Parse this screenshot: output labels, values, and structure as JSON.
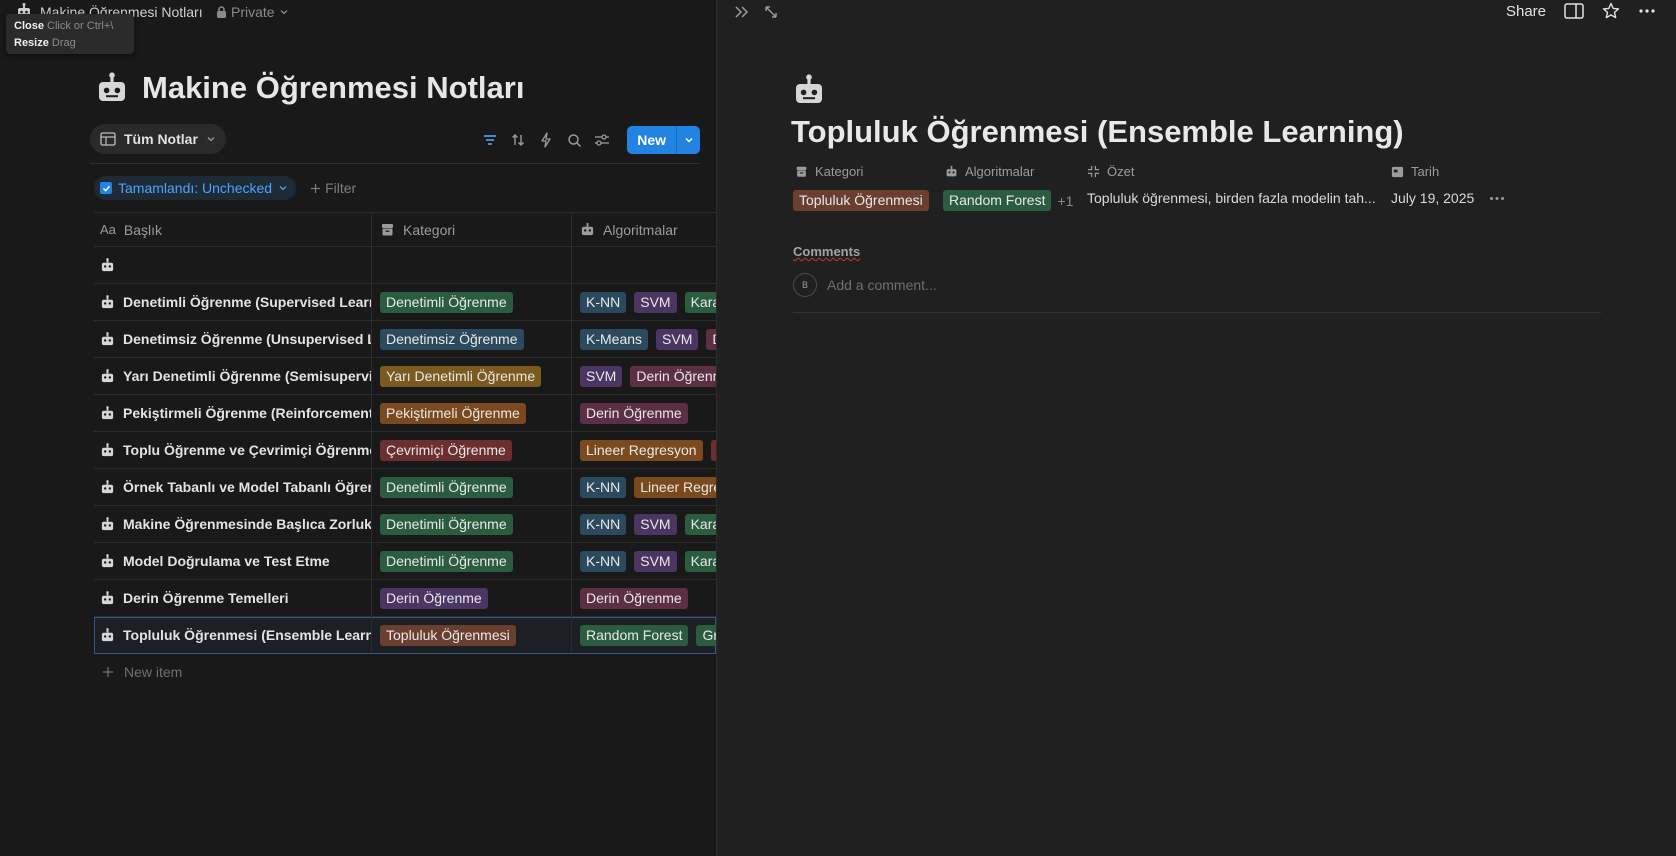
{
  "breadcrumb": {
    "title": "Makine Öğrenmesi Notları",
    "privacy": "Private"
  },
  "tooltip": {
    "close_label": "Close",
    "close_hint": "Click or Ctrl+\\",
    "resize_label": "Resize",
    "resize_hint": "Drag"
  },
  "database": {
    "title": "Makine Öğrenmesi Notları",
    "view_name": "Tüm Notlar",
    "new_label": "New",
    "filter_chip": "Tamamlandı: Unchecked",
    "add_filter": "Filter",
    "new_item": "New item",
    "columns": [
      "Başlık",
      "Kategori",
      "Algoritmalar"
    ],
    "rows": [
      {
        "title": "",
        "category": null,
        "algorithms": []
      },
      {
        "title": "Denetimli Öğrenme (Supervised Learning)",
        "category": {
          "label": "Denetimli Öğrenme",
          "color": "#2b5c3f"
        },
        "algorithms": [
          {
            "label": "K-NN",
            "color": "#2c4a5e"
          },
          {
            "label": "SVM",
            "color": "#4a3563"
          },
          {
            "label": "Karar Ağaçları",
            "color": "#2b5c3f"
          }
        ]
      },
      {
        "title": "Denetimsiz Öğrenme (Unsupervised Learning)",
        "category": {
          "label": "Denetimsiz Öğrenme",
          "color": "#2c4a5e"
        },
        "algorithms": [
          {
            "label": "K-Means",
            "color": "#2c4a5e"
          },
          {
            "label": "SVM",
            "color": "#4a3563"
          },
          {
            "label": "Derin Öğrenme",
            "color": "#5c2f45"
          }
        ]
      },
      {
        "title": "Yarı Denetimli Öğrenme (Semisupervised Learning)",
        "category": {
          "label": "Yarı Denetimli Öğrenme",
          "color": "#7a5a1e"
        },
        "algorithms": [
          {
            "label": "SVM",
            "color": "#4a3563"
          },
          {
            "label": "Derin Öğrenme",
            "color": "#5c2f45"
          }
        ]
      },
      {
        "title": "Pekiştirmeli Öğrenme (Reinforcement Learning)",
        "category": {
          "label": "Pekiştirmeli Öğrenme",
          "color": "#7a4a1e"
        },
        "algorithms": [
          {
            "label": "Derin Öğrenme",
            "color": "#5c2f45"
          }
        ]
      },
      {
        "title": "Toplu Öğrenme ve Çevrimiçi Öğrenme",
        "category": {
          "label": "Çevrimiçi Öğrenme",
          "color": "#6b2f2f"
        },
        "algorithms": [
          {
            "label": "Lineer Regresyon",
            "color": "#7a4a1e"
          },
          {
            "label": "Lojistik Regresyon",
            "color": "#6b2f2f"
          }
        ]
      },
      {
        "title": "Örnek Tabanlı ve Model Tabanlı Öğrenme",
        "category": {
          "label": "Denetimli Öğrenme",
          "color": "#2b5c3f"
        },
        "algorithms": [
          {
            "label": "K-NN",
            "color": "#2c4a5e"
          },
          {
            "label": "Lineer Regresyon",
            "color": "#7a4a1e"
          }
        ]
      },
      {
        "title": "Makine Öğrenmesinde Başlıca Zorluklar",
        "category": {
          "label": "Denetimli Öğrenme",
          "color": "#2b5c3f"
        },
        "algorithms": [
          {
            "label": "K-NN",
            "color": "#2c4a5e"
          },
          {
            "label": "SVM",
            "color": "#4a3563"
          },
          {
            "label": "Karar Ağaçları",
            "color": "#2b5c3f"
          }
        ]
      },
      {
        "title": "Model Doğrulama ve Test Etme",
        "category": {
          "label": "Denetimli Öğrenme",
          "color": "#2b5c3f"
        },
        "algorithms": [
          {
            "label": "K-NN",
            "color": "#2c4a5e"
          },
          {
            "label": "SVM",
            "color": "#4a3563"
          },
          {
            "label": "Karar Ağaçları",
            "color": "#2b5c3f"
          }
        ]
      },
      {
        "title": "Derin Öğrenme Temelleri",
        "category": {
          "label": "Derin Öğrenme",
          "color": "#4a3563"
        },
        "algorithms": [
          {
            "label": "Derin Öğrenme",
            "color": "#5c2f45"
          }
        ]
      },
      {
        "title": "Topluluk Öğrenmesi (Ensemble Learning)",
        "category": {
          "label": "Topluluk Öğrenmesi",
          "color": "#6b3f30"
        },
        "algorithms": [
          {
            "label": "Random Forest",
            "color": "#2b5c3f"
          },
          {
            "label": "Gradient Boosting",
            "color": "#2b5c3f"
          }
        ],
        "selected": true
      }
    ]
  },
  "page": {
    "title": "Topluluk Öğrenmesi (Ensemble Learning)",
    "share_label": "Share",
    "props": {
      "category_label": "Kategori",
      "category_value": "Topluluk Öğrenmesi",
      "category_color": "#6b3f30",
      "algorithms_label": "Algoritmalar",
      "algorithms_value": "Random Forest",
      "algorithms_color": "#2b5c3f",
      "algorithms_more": "+1",
      "summary_label": "Özet",
      "summary_value": "Topluluk öğrenmesi, birden fazla modelin tah...",
      "date_label": "Tarih",
      "date_value": "July 19, 2025"
    },
    "comments_label": "Comments",
    "comment_placeholder": "Add a comment...",
    "avatar_initial": "B"
  }
}
